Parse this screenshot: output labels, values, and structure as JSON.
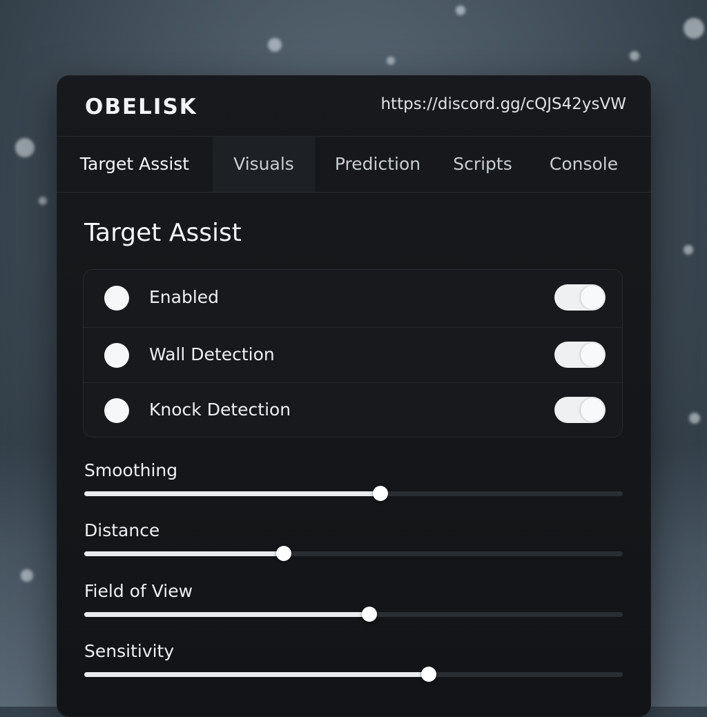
{
  "app": {
    "brand": "OBELISK",
    "invite_link": "https://discord.gg/cQJS42ysVW"
  },
  "tabs": [
    {
      "label": "Target Assist",
      "active": true
    },
    {
      "label": "Visuals",
      "active": false
    },
    {
      "label": "Prediction",
      "active": false
    },
    {
      "label": "Scripts",
      "active": false
    },
    {
      "label": "Console",
      "active": false
    }
  ],
  "section": {
    "title": "Target Assist"
  },
  "toggles": [
    {
      "label": "Enabled",
      "on": true
    },
    {
      "label": "Wall Detection",
      "on": true
    },
    {
      "label": "Knock Detection",
      "on": true
    }
  ],
  "sliders": [
    {
      "label": "Smoothing",
      "value_fraction": 0.55
    },
    {
      "label": "Distance",
      "value_fraction": 0.37
    },
    {
      "label": "Field of View",
      "value_fraction": 0.53
    },
    {
      "label": "Sensitivity",
      "value_fraction": 0.64
    }
  ],
  "colors": {
    "panel": "#141619",
    "accent": "#e9ebee",
    "text": "#eef0f2"
  }
}
